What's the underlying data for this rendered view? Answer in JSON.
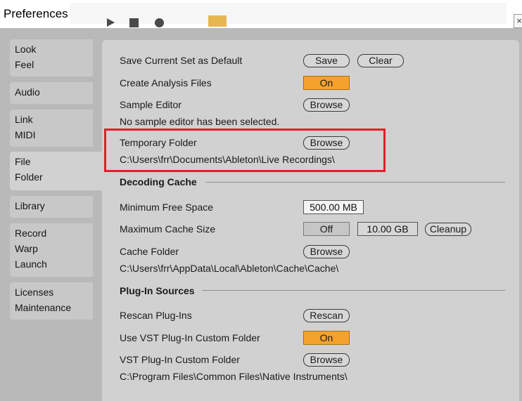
{
  "window": {
    "title": "Preferences",
    "close_glyph": "×"
  },
  "sidebar": {
    "tabs": [
      {
        "id": "look-feel",
        "lines": [
          "Look",
          "Feel"
        ]
      },
      {
        "id": "audio",
        "lines": [
          "Audio"
        ]
      },
      {
        "id": "link-midi",
        "lines": [
          "Link",
          "MIDI"
        ]
      },
      {
        "id": "file-folder",
        "lines": [
          "File",
          "Folder"
        ],
        "active": true
      },
      {
        "id": "library",
        "lines": [
          "Library"
        ]
      },
      {
        "id": "record-warp-launch",
        "lines": [
          "Record",
          "Warp",
          "Launch"
        ]
      },
      {
        "id": "licenses-maintenance",
        "lines": [
          "Licenses",
          "Maintenance"
        ]
      }
    ]
  },
  "file_folder": {
    "save_set": {
      "label": "Save Current Set as Default",
      "save_button": "Save",
      "clear_button": "Clear"
    },
    "analysis": {
      "label": "Create Analysis Files",
      "toggle": "On"
    },
    "sample_editor": {
      "label": "Sample Editor",
      "browse": "Browse",
      "status": "No sample editor has been selected."
    },
    "temporary_folder": {
      "label": "Temporary Folder",
      "browse": "Browse",
      "path": "C:\\Users\\frr\\Documents\\Ableton\\Live Recordings\\"
    },
    "decoding_cache": {
      "heading": "Decoding Cache",
      "min_free_space": {
        "label": "Minimum Free Space",
        "value": "500.00 MB"
      },
      "max_cache_size": {
        "label": "Maximum Cache Size",
        "toggle": "Off",
        "value": "10.00 GB",
        "cleanup": "Cleanup"
      },
      "cache_folder": {
        "label": "Cache Folder",
        "browse": "Browse",
        "path": "C:\\Users\\frr\\AppData\\Local\\Ableton\\Cache\\Cache\\"
      }
    },
    "plugin_sources": {
      "heading": "Plug-In Sources",
      "rescan": {
        "label": "Rescan Plug-Ins",
        "button": "Rescan"
      },
      "use_vst_custom": {
        "label": "Use VST Plug-In Custom Folder",
        "toggle": "On"
      },
      "vst_custom_folder": {
        "label": "VST Plug-In Custom Folder",
        "browse": "Browse",
        "path": "C:\\Program Files\\Common Files\\Native Instruments\\"
      }
    }
  },
  "colors": {
    "toggle_on": "#f5a22c",
    "highlight": "#e0202a",
    "panel": "#d1d1d1"
  }
}
